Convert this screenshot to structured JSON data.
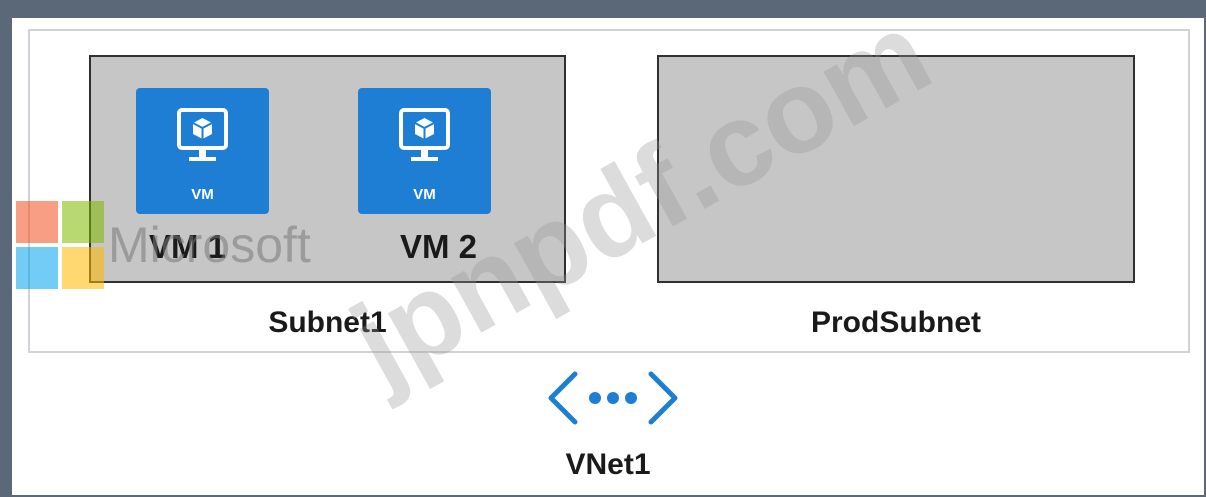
{
  "diagram": {
    "vnet": {
      "label": "VNet1",
      "icon": "virtual-network-icon",
      "color": "#1d7ed4"
    },
    "subnets": [
      {
        "label": "Subnet1",
        "vms": [
          {
            "tile_text": "VM",
            "name": "VM 1",
            "icon": "virtual-machine-icon"
          },
          {
            "tile_text": "VM",
            "name": "VM 2",
            "icon": "virtual-machine-icon"
          }
        ]
      },
      {
        "label": "ProdSubnet",
        "vms": []
      }
    ]
  },
  "watermarks": {
    "microsoft": "Microsoft",
    "site": "jpnpdf.com",
    "logo_colors": [
      "#f25022",
      "#7fba00",
      "#00a4ef",
      "#ffb900"
    ]
  },
  "colors": {
    "vm_tile": "#1d7ed4",
    "subnet_fill": "#c6c6c6",
    "frame_border": "#5b6877"
  }
}
